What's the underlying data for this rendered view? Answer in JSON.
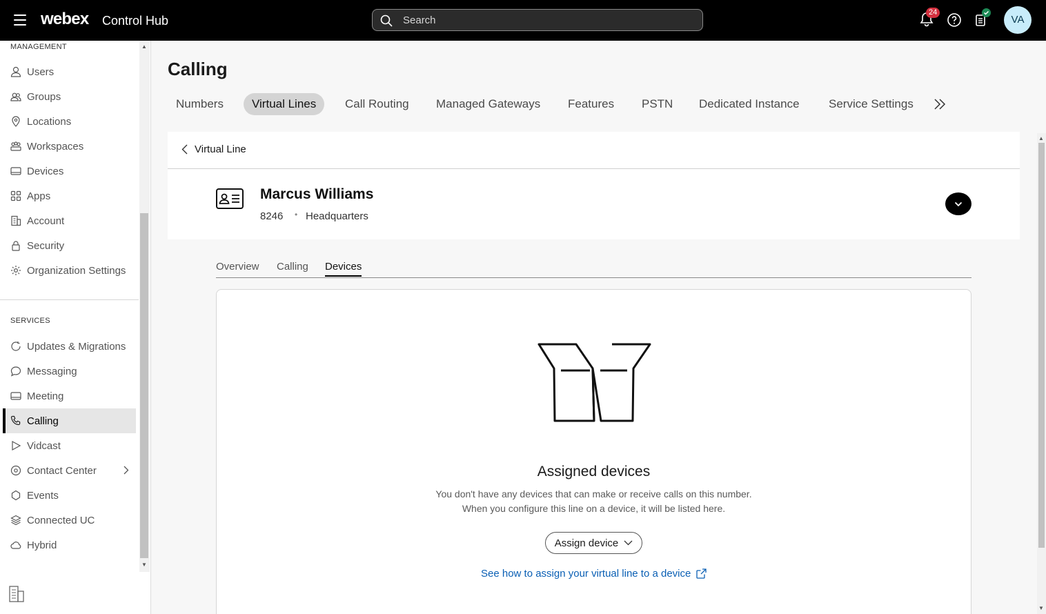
{
  "app": {
    "brand": "webex",
    "product": "Control Hub"
  },
  "search": {
    "placeholder": "Search"
  },
  "header": {
    "notification_count": "24",
    "avatar_initials": "VA"
  },
  "sidebar": {
    "management_label": "MANAGEMENT",
    "management_items": [
      {
        "label": "Users",
        "icon": "user-icon"
      },
      {
        "label": "Groups",
        "icon": "groups-icon"
      },
      {
        "label": "Locations",
        "icon": "location-pin-icon"
      },
      {
        "label": "Workspaces",
        "icon": "workspaces-icon"
      },
      {
        "label": "Devices",
        "icon": "device-icon"
      },
      {
        "label": "Apps",
        "icon": "apps-grid-icon"
      },
      {
        "label": "Account",
        "icon": "building-icon"
      },
      {
        "label": "Security",
        "icon": "lock-icon"
      },
      {
        "label": "Organization Settings",
        "icon": "gear-icon"
      }
    ],
    "services_label": "SERVICES",
    "services_items": [
      {
        "label": "Updates & Migrations",
        "icon": "refresh-icon"
      },
      {
        "label": "Messaging",
        "icon": "chat-bubble-icon"
      },
      {
        "label": "Meeting",
        "icon": "meeting-icon"
      },
      {
        "label": "Calling",
        "icon": "phone-icon",
        "active": true
      },
      {
        "label": "Vidcast",
        "icon": "play-icon"
      },
      {
        "label": "Contact Center",
        "icon": "contact-center-icon"
      },
      {
        "label": "Events",
        "icon": "events-icon"
      },
      {
        "label": "Connected UC",
        "icon": "layers-icon"
      },
      {
        "label": "Hybrid",
        "icon": "cloud-icon"
      }
    ]
  },
  "page": {
    "title": "Calling"
  },
  "tabs": [
    "Numbers",
    "Virtual Lines",
    "Call Routing",
    "Managed Gateways",
    "Features",
    "PSTN",
    "Dedicated Instance",
    "Service Settings"
  ],
  "active_tab": "Virtual Lines",
  "detail": {
    "back_label": "Virtual Line",
    "name": "Marcus Williams",
    "extension": "8246",
    "location": "Headquarters"
  },
  "subtabs": [
    "Overview",
    "Calling",
    "Devices"
  ],
  "active_subtab": "Devices",
  "devices": {
    "title": "Assigned devices",
    "line1": "You don't have any devices that can make or receive calls on this number.",
    "line2": "When you configure this line on a device, it will be listed here.",
    "assign_button": "Assign device",
    "help_link": "See how to assign your virtual line to a device"
  }
}
